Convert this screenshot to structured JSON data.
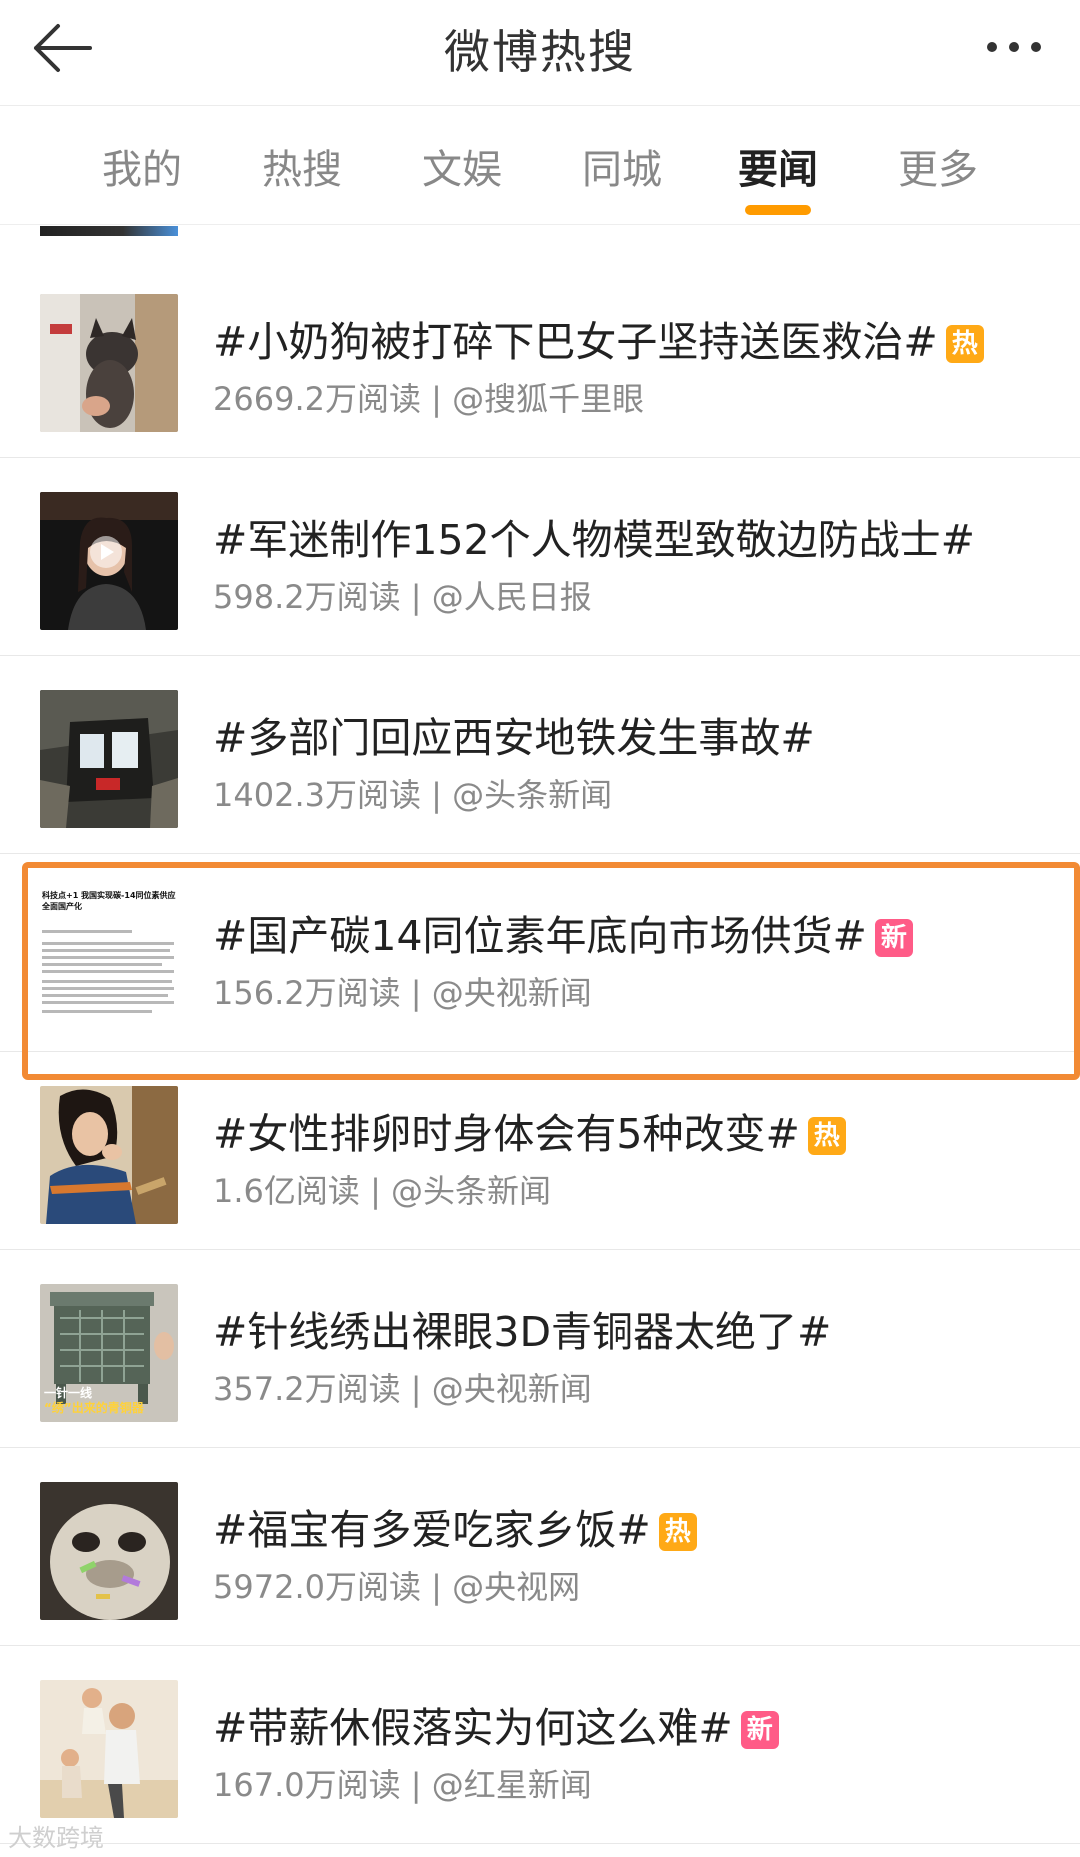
{
  "header": {
    "title": "微博热搜",
    "back_icon": "arrow-left-icon",
    "more_icon": "more-dots-icon"
  },
  "tabs": [
    {
      "label": "我的",
      "active": false
    },
    {
      "label": "热搜",
      "active": false
    },
    {
      "label": "文娱",
      "active": false
    },
    {
      "label": "同城",
      "active": false
    },
    {
      "label": "要闻",
      "active": true
    },
    {
      "label": "更多",
      "active": false
    }
  ],
  "accent_color": "#ff9b00",
  "highlight_color": "#f28a34",
  "badges": {
    "hot": {
      "label": "热",
      "color": "#ffa916"
    },
    "new": {
      "label": "新",
      "color": "#ff5b87"
    }
  },
  "items": [
    {
      "title": "#小奶狗被打碎下巴女子坚持送医救治#",
      "badge": "热",
      "badge_type": "hot",
      "reads": "2669.2万阅读",
      "source": "@搜狐千里眼",
      "thumb": "dog"
    },
    {
      "title": "#军迷制作152个人物模型致敬边防战士#",
      "badge": "",
      "badge_type": "",
      "reads": "598.2万阅读",
      "source": "@人民日报",
      "thumb": "woman-video"
    },
    {
      "title": "#多部门回应西安地铁发生事故#",
      "badge": "",
      "badge_type": "",
      "reads": "1402.3万阅读",
      "source": "@头条新闻",
      "thumb": "subway"
    },
    {
      "title": "#国产碳14同位素年底向市场供货#",
      "badge": "新",
      "badge_type": "new",
      "reads": "156.2万阅读",
      "source": "@央视新闻",
      "thumb": "document",
      "highlighted": true
    },
    {
      "title": "#女性排卵时身体会有5种改变#",
      "badge": "热",
      "badge_type": "hot",
      "reads": "1.6亿阅读",
      "source": "@头条新闻",
      "thumb": "woman-thinking"
    },
    {
      "title": "#针线绣出裸眼3D青铜器太绝了#",
      "badge": "",
      "badge_type": "",
      "reads": "357.2万阅读",
      "source": "@央视新闻",
      "thumb": "bronze"
    },
    {
      "title": "#福宝有多爱吃家乡饭#",
      "badge": "热",
      "badge_type": "hot",
      "reads": "5972.0万阅读",
      "source": "@央视网",
      "thumb": "panda"
    },
    {
      "title": "#带薪休假落实为何这么难#",
      "badge": "新",
      "badge_type": "new",
      "reads": "167.0万阅读",
      "source": "@红星新闻",
      "thumb": "family"
    }
  ],
  "thumb_texts": {
    "document_headline": "科技点+1 我国实现碳-14同位素供应全面国产化",
    "bronze_caption_1": "一针一线",
    "bronze_caption_2": "“绣”出来的青铜器"
  },
  "watermark": "大数跨境"
}
